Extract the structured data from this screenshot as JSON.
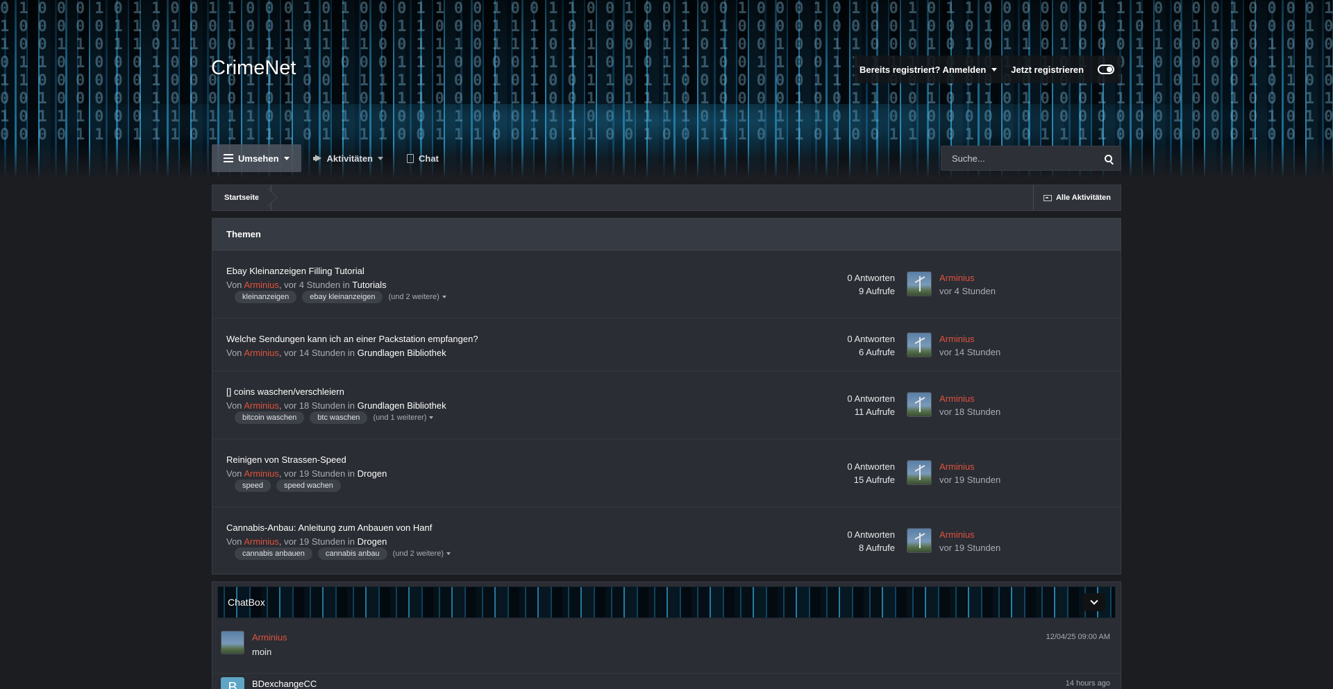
{
  "site": {
    "title": "CrimeNet"
  },
  "userbar": {
    "login_label": "Bereits registriert? Anmelden",
    "register_label": "Jetzt registrieren"
  },
  "nav": {
    "items": [
      {
        "label": "Umsehen",
        "icon": "list-icon",
        "active": true
      },
      {
        "label": "Aktivitäten",
        "icon": "megaphone-icon",
        "active": false
      },
      {
        "label": "Chat",
        "icon": "document-icon",
        "active": false
      }
    ],
    "search_placeholder": "Suche..."
  },
  "breadcrumb": {
    "home": "Startseite",
    "all_activity": "Alle Aktivitäten"
  },
  "topics": {
    "header": "Themen",
    "items": [
      {
        "title": "Ebay Kleinanzeigen Filling Tutorial",
        "by": "Von",
        "author": "Arminius",
        "time": ", vor 4 Stunden in",
        "category": "Tutorials",
        "tags": [
          "kleinanzeigen",
          "ebay kleinanzeigen"
        ],
        "more_tags": "(und 2 weitere)",
        "replies": "0 Antworten",
        "views": "9 Aufrufe",
        "last_user": "Arminius",
        "last_time": "vor 4 Stunden"
      },
      {
        "title": "Welche Sendungen kann ich an einer Packstation empfangen?",
        "by": "Von",
        "author": "Arminius",
        "time": ", vor 14 Stunden in",
        "category": "Grundlagen Bibliothek",
        "tags": [],
        "more_tags": "",
        "replies": "0 Antworten",
        "views": "6 Aufrufe",
        "last_user": "Arminius",
        "last_time": "vor 14 Stunden"
      },
      {
        "title": "[] coins waschen/verschleiern",
        "by": "Von",
        "author": "Arminius",
        "time": ", vor 18 Stunden in",
        "category": "Grundlagen Bibliothek",
        "tags": [
          "bitcoin waschen",
          "btc waschen"
        ],
        "more_tags": "(und 1 weiterer)",
        "replies": "0 Antworten",
        "views": "11 Aufrufe",
        "last_user": "Arminius",
        "last_time": "vor 18 Stunden"
      },
      {
        "title": "Reinigen von Strassen-Speed",
        "by": "Von",
        "author": "Arminius",
        "time": ", vor 19 Stunden in",
        "category": "Drogen",
        "tags": [
          "speed",
          "speed wachen"
        ],
        "more_tags": "",
        "replies": "0 Antworten",
        "views": "15 Aufrufe",
        "last_user": "Arminius",
        "last_time": "vor 19 Stunden"
      },
      {
        "title": "Cannabis-Anbau: Anleitung zum Anbauen von Hanf",
        "by": "Von",
        "author": "Arminius",
        "time": ", vor 19 Stunden in",
        "category": "Drogen",
        "tags": [
          "cannabis anbauen",
          "cannabis anbau"
        ],
        "more_tags": "(und 2 weitere)",
        "replies": "0 Antworten",
        "views": "8 Aufrufe",
        "last_user": "Arminius",
        "last_time": "vor 19 Stunden"
      }
    ]
  },
  "chatbox": {
    "title": "ChatBox",
    "messages": [
      {
        "user": "Arminius",
        "user_color": "#e0523f",
        "text": "moin",
        "time": "12/04/25 09:00 AM",
        "avatar": "photo"
      },
      {
        "user": "BDexchangeCC",
        "user_color": "#ffffff",
        "avatar_letter": "B",
        "text": "",
        "time": "14 hours ago",
        "avatar": "letter"
      }
    ]
  },
  "colors": {
    "accent": "#e0523f",
    "panel": "#2a2d33",
    "background": "#1b1d21"
  }
}
